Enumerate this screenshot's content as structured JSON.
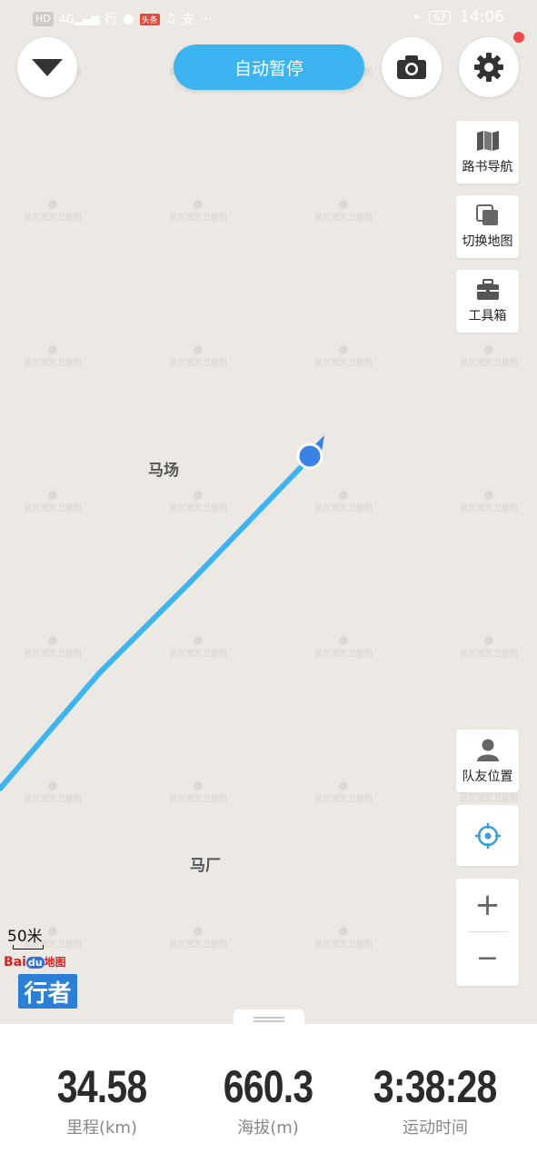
{
  "status_bar": {
    "left_chips": [
      "HD",
      "4G",
      "行"
    ],
    "time": "14:06",
    "battery": "67"
  },
  "top": {
    "auto_pause_label": "自动暂停"
  },
  "side_buttons": {
    "roadbook_nav": "路书导航",
    "switch_map": "切换地图",
    "toolbox": "工具箱",
    "teammate_location": "队友位置"
  },
  "map": {
    "places": [
      "马场",
      "马厂"
    ],
    "scale_label": "50米",
    "watermark_text": "此区域无卫星图",
    "baidu_logo": {
      "bai": "Bai",
      "du": "du",
      "suffix": "地图"
    },
    "app_logo": "行者",
    "route_color": "#3db4f2"
  },
  "zoom": {
    "plus": "+",
    "minus": "−"
  },
  "stats": [
    {
      "value": "34.58",
      "label": "里程(km)"
    },
    {
      "value": "660.3",
      "label": "海拔(m)"
    },
    {
      "value": "3:38:28",
      "label": "运动时间"
    }
  ],
  "colors": {
    "accent": "#3db4f2",
    "map_bg": "#ece9e4",
    "notification": "#f24848"
  }
}
